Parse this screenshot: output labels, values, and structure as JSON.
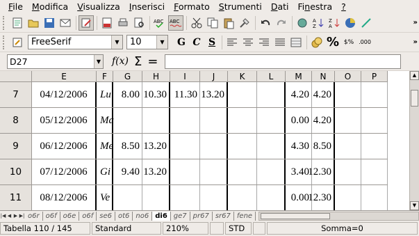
{
  "menu": [
    "File",
    "Modifica",
    "Visualizza",
    "Inserisci",
    "Formato",
    "Strumenti",
    "Dati",
    "Finestra",
    "?"
  ],
  "menu_underline": [
    "F",
    "M",
    "V",
    "I",
    "F",
    "S",
    "D",
    "n",
    "?"
  ],
  "font": {
    "name": "FreeSerif",
    "size": "10"
  },
  "format_buttons": {
    "bold": "G",
    "italic": "C",
    "underline": "S"
  },
  "formula": {
    "cell_ref": "D27",
    "fx": "f(x)",
    "sum": "Σ",
    "equals": "=",
    "value": ""
  },
  "columns": [
    "E",
    "F",
    "G",
    "H",
    "I",
    "J",
    "K",
    "L",
    "M",
    "N",
    "O",
    "P"
  ],
  "rows": [
    {
      "num": "7",
      "date": "04/12/2006",
      "day": "Lu",
      "g": "8.00",
      "h": "10.30",
      "i": "11.30",
      "j": "13.20",
      "m": "4.20",
      "n": "4.20"
    },
    {
      "num": "8",
      "date": "05/12/2006",
      "day": "Ma",
      "g": "",
      "h": "",
      "i": "",
      "j": "",
      "m": "0.00",
      "n": "4.20"
    },
    {
      "num": "9",
      "date": "06/12/2006",
      "day": "Me",
      "g": "8.50",
      "h": "13.20",
      "i": "",
      "j": "",
      "m": "4.30",
      "n": "8.50"
    },
    {
      "num": "10",
      "date": "07/12/2006",
      "day": "Gi",
      "g": "9.40",
      "h": "13.20",
      "i": "",
      "j": "",
      "m": "3.40",
      "n": "12.30"
    },
    {
      "num": "11",
      "date": "08/12/2006",
      "day": "Ve",
      "g": "",
      "h": "",
      "i": "",
      "j": "",
      "m": "0.00",
      "n": "12.30"
    }
  ],
  "sheet_tabs": [
    "o6r",
    "o6f",
    "o6e",
    "o6f",
    "se6",
    "ot6",
    "no6",
    "di6",
    "ge7",
    "pr67",
    "sr67",
    "fene"
  ],
  "active_tab": "di6",
  "status": {
    "sheet": "Tabella 110 / 145",
    "style": "Standard",
    "zoom": "210%",
    "mode": "STD",
    "sum": "Somma=0"
  }
}
